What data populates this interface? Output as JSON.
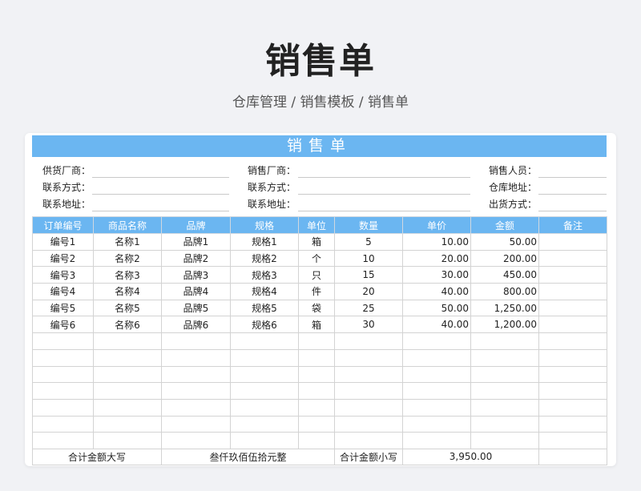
{
  "page": {
    "title": "销售单",
    "breadcrumb": "仓库管理 / 销售模板 / 销售单"
  },
  "sheet": {
    "title": "销售单",
    "info": [
      [
        "供货厂商：",
        "销售厂商：",
        "销售人员："
      ],
      [
        "联系方式：",
        "联系方式：",
        "仓库地址："
      ],
      [
        "联系地址：",
        "联系地址：",
        "出货方式："
      ]
    ],
    "columns": [
      "订单编号",
      "商品名称",
      "品牌",
      "规格",
      "单位",
      "数量",
      "单价",
      "金额",
      "备注"
    ],
    "rows": [
      [
        "编号1",
        "名称1",
        "品牌1",
        "规格1",
        "箱",
        "5",
        "10.00",
        "50.00",
        ""
      ],
      [
        "编号2",
        "名称2",
        "品牌2",
        "规格2",
        "个",
        "10",
        "20.00",
        "200.00",
        ""
      ],
      [
        "编号3",
        "名称3",
        "品牌3",
        "规格3",
        "只",
        "15",
        "30.00",
        "450.00",
        ""
      ],
      [
        "编号4",
        "名称4",
        "品牌4",
        "规格4",
        "件",
        "20",
        "40.00",
        "800.00",
        ""
      ],
      [
        "编号5",
        "名称5",
        "品牌5",
        "规格5",
        "袋",
        "25",
        "50.00",
        "1,250.00",
        ""
      ],
      [
        "编号6",
        "名称6",
        "品牌6",
        "规格6",
        "箱",
        "30",
        "40.00",
        "1,200.00",
        ""
      ]
    ],
    "empty_rows": 7,
    "footer": {
      "total_upper_label": "合计金额大写",
      "total_upper_value": "叁仟玖佰伍拾元整",
      "total_lower_label": "合计金额小写",
      "total_lower_value": "3,950.00"
    }
  },
  "colors": {
    "accent": "#6bb6f1",
    "background": "#f1f2f5"
  }
}
